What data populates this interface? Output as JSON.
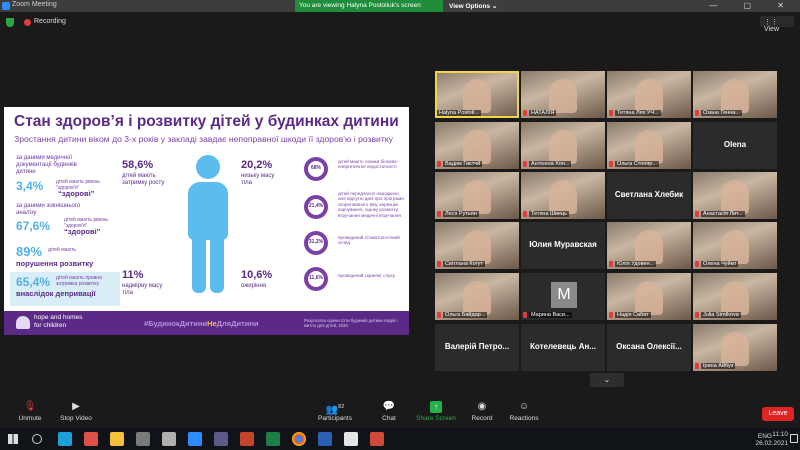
{
  "window": {
    "app_title": "Zoom Meeting",
    "viewing_banner": "You are viewing Halyna Postoliuk's screen",
    "view_options": "View Options ⌄",
    "controls": "— ▢ ✕"
  },
  "meeting": {
    "recording_label": "Recording",
    "view_button": "⋮⋮ View"
  },
  "slide": {
    "title": "Стан здоров’я і розвитку дітей у будинках дитини",
    "subtitle": "Зростання дитини віком до 3-х років у закладі завдає непоправної шкоди її здоров'ю і розвитку",
    "medical_docs_label": "за даними медичної документації будинків дитини",
    "pct_healthy_docs": "3,4%",
    "note_healthy_docs": "дітей мають рівень \"здоров'я\"",
    "healthy_word_1": "“здорові”",
    "external_label": "за даними зовнішнього аналізу",
    "pct_healthy_ext": "67,6%",
    "note_healthy_ext": "дітей мають рівень \"здоров'я\"",
    "healthy_word_2": "“здорові”",
    "pct_dev": "89%",
    "note_dev": "дітей мають",
    "dev_word": "порушення розвитку",
    "pct_deprivation": "65,4%",
    "note_deprivation": "дітей мають правна затримка розвитку",
    "deprivation_word": "внаслідок депривації",
    "pct_growth": "58,6%",
    "txt_growth": "дітей мають затримку росту",
    "pct_low_weight": "20,2%",
    "txt_low_weight": "низьку масу тіла",
    "pct_excess_weight": "11%",
    "txt_excess_weight": "надмірну масу тіла",
    "pct_obesity": "10,6%",
    "txt_obesity": "ожиріння",
    "ring_1_val": "68%",
    "ring_1_txt": "дітей мають ознаки білково-енергетичної недостатності",
    "ring_2_val": "21,4%",
    "ring_2_txt": "дітей передчасно народжені, але відсутні дані про програми скорегованого віку, корекцію харчування, оцінку розвитку, втручання медичні втручання",
    "ring_3_val": "31,2%",
    "ring_3_txt": "проведений стоматологічний огляд",
    "ring_4_val": "11,6%",
    "ring_4_txt": "проведений скринінг слуху",
    "logo_line1": "hope and homes",
    "logo_line2": "for children",
    "hashtag_a": "#БудинокДитини",
    "hashtag_b": "Не",
    "hashtag_c": "ДляДитини",
    "source": "Результати оцінки 11ти будинків дитини Надія і житло для дітей, 2020"
  },
  "gallery": [
    {
      "name": "Halyna Postoli...",
      "type": "photo",
      "active": true,
      "mic": false
    },
    {
      "name": "НАТАЛІЯ",
      "type": "photo",
      "active": false,
      "mic": true
    },
    {
      "name": "Тетяна Лях УЧ...",
      "type": "photo",
      "active": false,
      "mic": true
    },
    {
      "name": "Озана Генна...",
      "type": "photo",
      "active": false,
      "mic": true
    },
    {
      "name": "Вадим Гаєтчй",
      "type": "photo",
      "active": false,
      "mic": true
    },
    {
      "name": "Антоніна Хон...",
      "type": "photo",
      "active": false,
      "mic": true
    },
    {
      "name": "Ольга Стопяр...",
      "type": "photo",
      "active": false,
      "mic": true
    },
    {
      "name": "Olena",
      "type": "text",
      "active": false,
      "mic": false
    },
    {
      "name": "Леся Рутьян",
      "type": "photo",
      "active": false,
      "mic": true
    },
    {
      "name": "Тетяна Швець",
      "type": "photo",
      "active": false,
      "mic": true
    },
    {
      "name": "Светлана Хлебик",
      "type": "text",
      "active": false,
      "mic": false
    },
    {
      "name": "Анастасія Лит...",
      "type": "photo",
      "active": false,
      "mic": true
    },
    {
      "name": "Світлана Когут",
      "type": "photo",
      "active": false,
      "mic": true
    },
    {
      "name": "Юлия Муравская",
      "type": "text",
      "active": false,
      "mic": false
    },
    {
      "name": "Юлія Удовен...",
      "type": "photo",
      "active": false,
      "mic": true
    },
    {
      "name": "Олена Чуйко",
      "type": "photo",
      "active": false,
      "mic": true
    },
    {
      "name": "Ольга Байдар...",
      "type": "photo",
      "active": false,
      "mic": true
    },
    {
      "name": "Марина Васи...",
      "type": "letter",
      "letter": "M",
      "active": false,
      "mic": true
    },
    {
      "name": "Надія Сабат",
      "type": "photo",
      "active": false,
      "mic": true
    },
    {
      "name": "Julia Strelkova",
      "type": "photo",
      "active": false,
      "mic": true
    },
    {
      "name": "Валерій Петро...",
      "type": "text",
      "active": false,
      "mic": false
    },
    {
      "name": "Котелевець Ан...",
      "type": "text",
      "active": false,
      "mic": false
    },
    {
      "name": "Оксана Олексії...",
      "type": "text",
      "active": false,
      "mic": false
    },
    {
      "name": "Ірина Айбуз",
      "type": "photo",
      "active": false,
      "mic": true
    }
  ],
  "gallery_more": "⌄",
  "toolbar": {
    "unmute": "Unmute",
    "stop_video": "Stop Video",
    "participants": "Participants",
    "participants_count": "82",
    "chat": "Chat",
    "share_screen": "Share Screen",
    "record": "Record",
    "reactions": "Reactions",
    "leave": "Leave"
  },
  "taskbar": {
    "lang": "ENG",
    "time": "11:10",
    "date": "26.02.2021"
  },
  "colors": {
    "slide_purple": "#5b2a86",
    "slide_blue": "#52b1e6",
    "banner_green": "#1f8d3a",
    "leave_red": "#e02424"
  }
}
